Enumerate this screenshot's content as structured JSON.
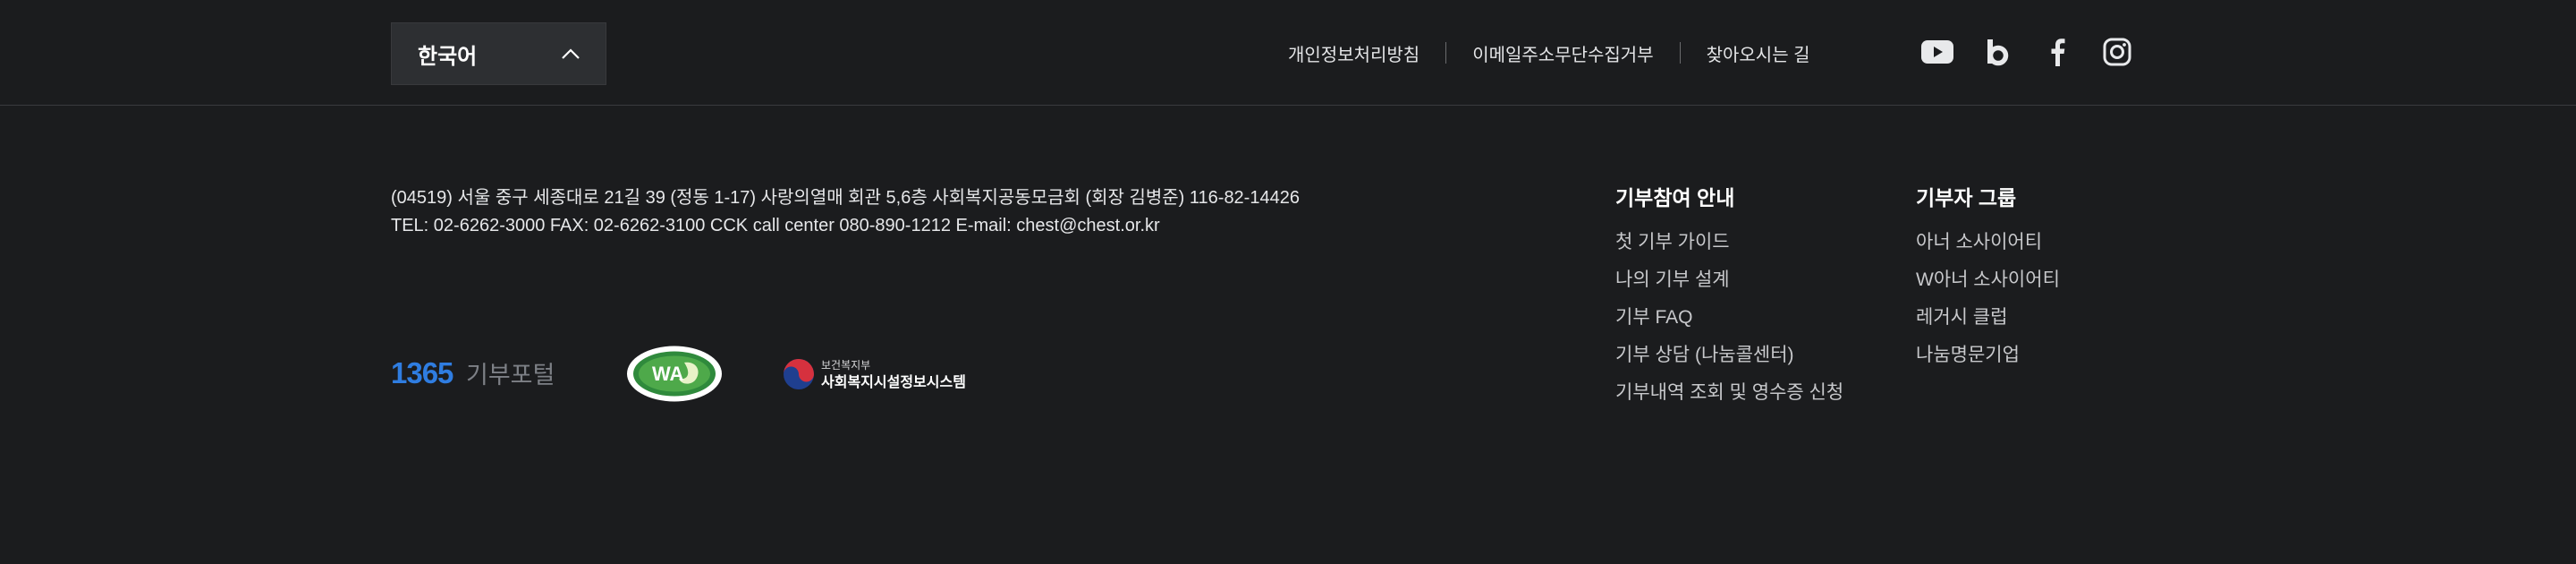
{
  "language": {
    "selected": "한국어"
  },
  "top_links": [
    "개인정보처리방침",
    "이메일주소무단수집거부",
    "찾아오시는 길"
  ],
  "social": [
    {
      "name": "youtube-icon"
    },
    {
      "name": "blog-icon"
    },
    {
      "name": "facebook-icon"
    },
    {
      "name": "instagram-icon"
    }
  ],
  "address": {
    "line1": "(04519) 서울 중구 세종대로 21길 39 (정동 1-17) 사랑의열매 회관 5,6층 사회복지공동모금회 (회장 김병준) 116-82-14426",
    "line2": "TEL: 02-6262-3000  FAX: 02-6262-3100   CCK call center 080-890-1212  E-mail: chest@chest.or.kr"
  },
  "logos": {
    "logo_1365_num": "1365",
    "logo_1365_text": "기부포털",
    "wa_text": "WA",
    "mohw_top": "보건복지부",
    "mohw_bottom": "사회복지시설정보시스템"
  },
  "columns": [
    {
      "title": "기부참여 안내",
      "items": [
        "첫 기부 가이드",
        "나의 기부 설계",
        "기부 FAQ",
        "기부 상담 (나눔콜센터)",
        "기부내역 조회 및 영수증 신청"
      ]
    },
    {
      "title": "기부자 그룹",
      "items": [
        "아너 소사이어티",
        "W아너 소사이어티",
        "레거시 클럽",
        "나눔명문기업"
      ]
    }
  ],
  "colors": {
    "background": "#1b1c1e",
    "select_bg": "#2d2f32",
    "accent_blue": "#2f7de1"
  }
}
